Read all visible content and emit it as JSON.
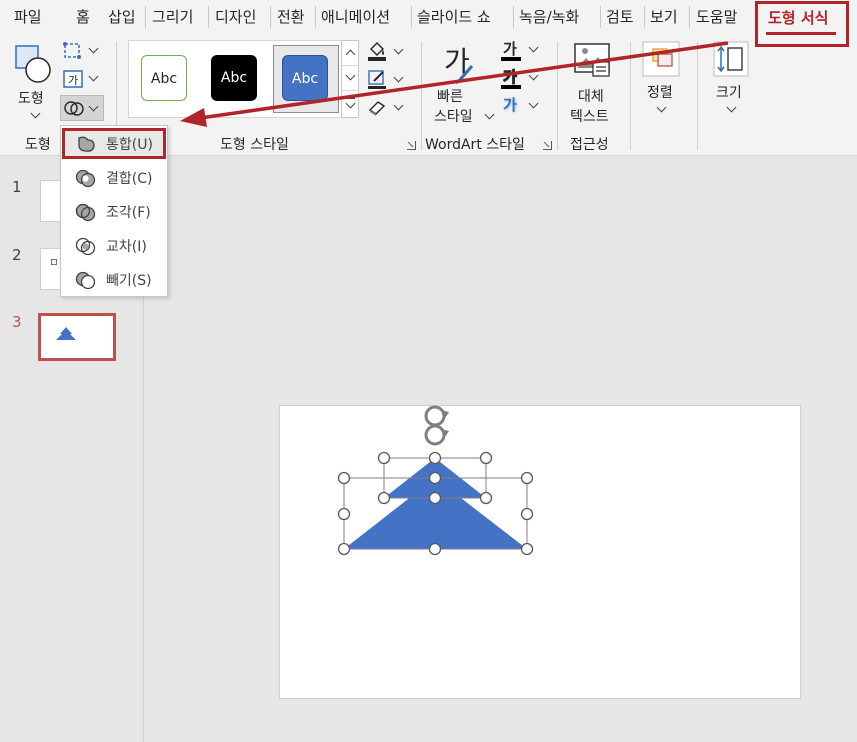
{
  "tabs": [
    {
      "label": "파일"
    },
    {
      "label": "홈"
    },
    {
      "label": "삽입"
    },
    {
      "label": "그리기"
    },
    {
      "label": "디자인"
    },
    {
      "label": "전환"
    },
    {
      "label": "애니메이션"
    },
    {
      "label": "슬라이드 쇼"
    },
    {
      "label": "녹음/녹화"
    },
    {
      "label": "검토"
    },
    {
      "label": "보기"
    },
    {
      "label": "도움말"
    }
  ],
  "active_tab": {
    "label": "도형 서식"
  },
  "ribbon": {
    "insert_shapes": {
      "shapes_button_label": "도형",
      "group_label": "도형"
    },
    "shape_styles": {
      "group_label": "도형 스타일",
      "thumbnails": [
        {
          "label": "Abc"
        },
        {
          "label": "Abc"
        },
        {
          "label": "Abc"
        }
      ]
    },
    "wordart_styles": {
      "group_label": "WordArt 스타일",
      "quick_styles_label_line1": "빠른",
      "quick_styles_label_line2": "스타일",
      "glyph": "가"
    },
    "accessibility": {
      "group_label": "접근성",
      "alt_text_line1": "대체",
      "alt_text_line2": "텍스트"
    },
    "arrange": {
      "label": "정렬"
    },
    "size": {
      "label": "크기"
    }
  },
  "merge_shapes_menu": {
    "items": [
      {
        "label": "통합(U)"
      },
      {
        "label": "결합(C)"
      },
      {
        "label": "조각(F)"
      },
      {
        "label": "교차(I)"
      },
      {
        "label": "빼기(S)"
      }
    ],
    "highlighted_index": 0
  },
  "slides": [
    {
      "number": "1"
    },
    {
      "number": "2"
    },
    {
      "number": "3",
      "selected": true
    }
  ],
  "colors": {
    "accent": "#b0242a",
    "shape_fill": "#4472c4",
    "selected_slide_number": "#c0504d"
  }
}
